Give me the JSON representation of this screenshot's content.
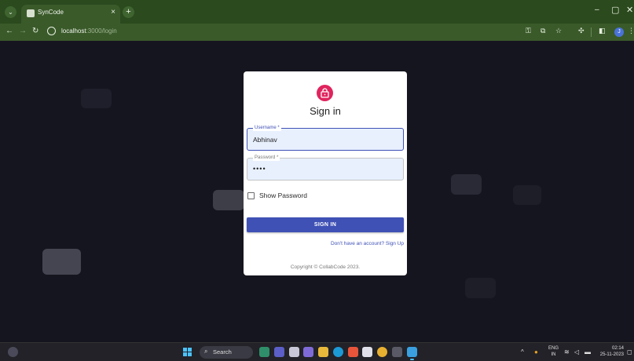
{
  "browser": {
    "tab_title": "SynCode",
    "tab_close": "×",
    "new_tab": "+",
    "window_controls": {
      "minimize": "–",
      "maximize": "▢",
      "close": "✕"
    },
    "url_host": "localhost",
    "url_path": ":3000/login",
    "toolbar_icons": [
      "key-icon",
      "install-icon",
      "star-icon",
      "extensions-icon",
      "sidebar-icon",
      "profile-icon"
    ],
    "profile_initial": "J"
  },
  "login": {
    "title": "Sign in",
    "username_label": "Username *",
    "username_value": "Abhinav",
    "password_label": "Password *",
    "password_value": "••••",
    "show_password_label": "Show Password",
    "show_password_checked": false,
    "submit_label": "SIGN IN",
    "signup_link": "Don't have an account? Sign Up",
    "copyright": "Copyright © CollabCode 2023."
  },
  "colors": {
    "accent": "#3f51b5",
    "lock_icon_bg": "#e0245e",
    "page_bg": "#15151f",
    "chrome_bg": "#3a5a2a"
  },
  "taskbar": {
    "search_placeholder": "Search",
    "apps": [
      "file-manager-icon",
      "teams-icon",
      "media-icon",
      "chat-icon",
      "folder-icon",
      "edge-icon",
      "brave-icon",
      "store-icon",
      "chrome-icon",
      "terminal-icon",
      "vscode-icon"
    ],
    "tray_chevron": "^",
    "lang_line1": "ENG",
    "lang_line2": "IN",
    "time": "02:14",
    "date": "25-11-2023"
  }
}
